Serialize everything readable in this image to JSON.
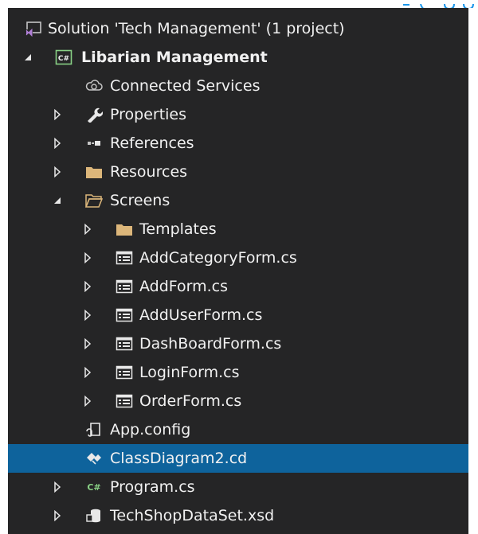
{
  "colors": {
    "background": "#252526",
    "text": "#f1f1f1",
    "selection": "#0e639c",
    "folder": "#dcb67a",
    "accent_blue": "#1c97ea"
  },
  "tree": [
    {
      "id": "solution",
      "label": "Solution 'Tech Management' (1 project)",
      "icon": "solution-icon",
      "expander": "none",
      "bold": false,
      "selected": false
    },
    {
      "id": "project",
      "label": "Libarian Management",
      "icon": "csharp-project-icon",
      "expander": "expanded",
      "bold": true,
      "selected": false
    },
    {
      "id": "connected-services",
      "label": "Connected Services",
      "icon": "cloud-services-icon",
      "expander": "none",
      "bold": false,
      "selected": false
    },
    {
      "id": "properties",
      "label": "Properties",
      "icon": "wrench-icon",
      "expander": "collapsed",
      "bold": false,
      "selected": false
    },
    {
      "id": "references",
      "label": "References",
      "icon": "references-icon",
      "expander": "collapsed",
      "bold": false,
      "selected": false
    },
    {
      "id": "resources",
      "label": "Resources",
      "icon": "folder-icon",
      "expander": "collapsed",
      "bold": false,
      "selected": false
    },
    {
      "id": "screens",
      "label": "Screens",
      "icon": "folder-open-icon",
      "expander": "expanded",
      "bold": false,
      "selected": false
    },
    {
      "id": "templates",
      "label": "Templates",
      "icon": "folder-icon",
      "expander": "collapsed",
      "bold": false,
      "selected": false
    },
    {
      "id": "addcategoryform",
      "label": "AddCategoryForm.cs",
      "icon": "form-icon",
      "expander": "collapsed",
      "bold": false,
      "selected": false
    },
    {
      "id": "addform",
      "label": "AddForm.cs",
      "icon": "form-icon",
      "expander": "collapsed",
      "bold": false,
      "selected": false
    },
    {
      "id": "adduserform",
      "label": "AddUserForm.cs",
      "icon": "form-icon",
      "expander": "collapsed",
      "bold": false,
      "selected": false
    },
    {
      "id": "dashboardform",
      "label": "DashBoardForm.cs",
      "icon": "form-icon",
      "expander": "collapsed",
      "bold": false,
      "selected": false
    },
    {
      "id": "loginform",
      "label": "LoginForm.cs",
      "icon": "form-icon",
      "expander": "collapsed",
      "bold": false,
      "selected": false
    },
    {
      "id": "orderform",
      "label": "OrderForm.cs",
      "icon": "form-icon",
      "expander": "collapsed",
      "bold": false,
      "selected": false
    },
    {
      "id": "appconfig",
      "label": "App.config",
      "icon": "config-icon",
      "expander": "none",
      "bold": false,
      "selected": false
    },
    {
      "id": "classdiagram",
      "label": "ClassDiagram2.cd",
      "icon": "class-diagram-icon",
      "expander": "none",
      "bold": false,
      "selected": true
    },
    {
      "id": "program",
      "label": "Program.cs",
      "icon": "csharp-file-icon",
      "expander": "collapsed",
      "bold": false,
      "selected": false
    },
    {
      "id": "dataset",
      "label": "TechShopDataSet.xsd",
      "icon": "dataset-icon",
      "expander": "collapsed",
      "bold": false,
      "selected": false
    }
  ]
}
